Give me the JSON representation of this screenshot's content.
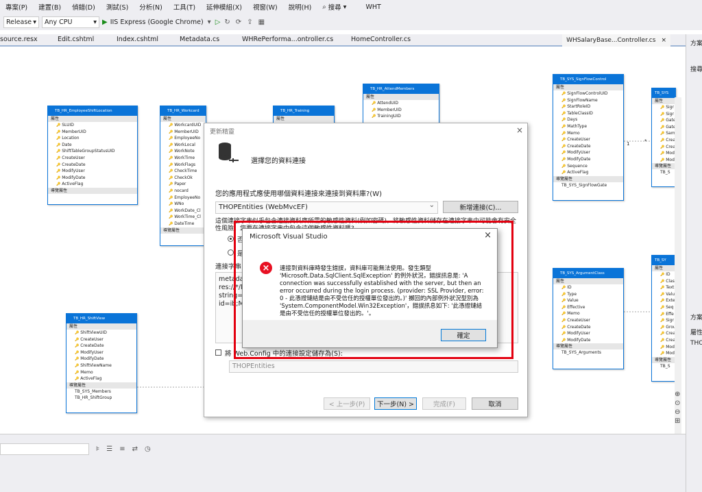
{
  "menu": {
    "items": [
      "專案(P)",
      "建置(B)",
      "偵錯(D)",
      "測試(S)",
      "分析(N)",
      "工具(T)",
      "延伸模組(X)",
      "視窗(W)",
      "說明(H)"
    ],
    "search_label": "搜尋",
    "search_icon": "search-icon",
    "solution_name": "WHT"
  },
  "toolbar": {
    "config": "Release",
    "platform": "Any CPU",
    "run_label": "IIS Express (Google Chrome)"
  },
  "tabs": [
    "source.resx",
    "Edit.cshtml",
    "Index.cshtml",
    "Metadata.cs",
    "WHRePerforma...ontroller.cs",
    "HomeController.cs"
  ],
  "tab_right": {
    "label": "WHSalaryBase...Controller.cs",
    "close": "×"
  },
  "rightpanel": {
    "text1": "方案",
    "text2": "搜尋",
    "text3": "方案",
    "text4": "屬性",
    "text5": "THO"
  },
  "entities": {
    "sec_props": "屬性",
    "sec_nav": "導覽屬性",
    "shift_location": {
      "title": "TB_HR_EmployeeShiftLocation",
      "props": [
        "SLUID",
        "MemberUID",
        "Location",
        "Date",
        "ShiftTableGroupStatusUID",
        "CreateUser",
        "CreateDate",
        "ModifyUser",
        "ModifyDate",
        "ActiveFlag"
      ]
    },
    "workcard": {
      "title": "TB_HR_Workcard",
      "props": [
        "WorkcardUID",
        "MemberUID",
        "EmployeeNo",
        "WorkLocal",
        "WorkNote",
        "WorkTime",
        "WorkFlags",
        "CheckTime",
        "CheckOk",
        "Paper",
        "nocard",
        "EmployeeNo",
        "WNo",
        "WorkDate_Cl",
        "WorkTime_Cl",
        "DateTime"
      ]
    },
    "training": {
      "title": "TB_HR_Training"
    },
    "attend": {
      "title": "TB_HR_AttendMembers",
      "props": [
        "AttendUID",
        "MemberUID",
        "TrainingUID"
      ]
    },
    "signflow": {
      "title": "TB_SYS_SignFlowControl",
      "props": [
        "SignFlowControlUID",
        "SignFlowName",
        "StartRoleID",
        "TableClassID",
        "Days",
        "MathType",
        "Memo",
        "CreateUser",
        "CreateDate",
        "ModifyUser",
        "ModifyDate",
        "Sequence",
        "ActiveFlag"
      ],
      "navs": [
        "TB_SYS_SignFlowGate"
      ]
    },
    "right_top": {
      "title": "TB_SYS",
      "props": [
        "Sigr",
        "Sigr",
        "Gate",
        "Gate",
        "Sam",
        "Crea",
        "Crea",
        "Mod",
        "Mod"
      ],
      "navs": [
        "TB_S"
      ]
    },
    "shiftview": {
      "title": "TB_HR_ShiftView",
      "props": [
        "ShiftViewUID",
        "CreateUser",
        "CreateDate",
        "ModifyUser",
        "ModifyDate",
        "ShiftViewName",
        "Memo",
        "ActiveFlag"
      ],
      "navs": [
        "TB_SYS_Members",
        "TB_HR_ShiftGroup"
      ]
    },
    "argclass": {
      "title": "TB_SYS_ArgumentClass",
      "props": [
        "ID",
        "Type",
        "Value",
        "Effective",
        "Memo",
        "CreateUser",
        "CreateDate",
        "ModifyUser",
        "ModifyDate"
      ],
      "navs": [
        "TB_SYS_Arguments"
      ]
    },
    "right_bottom": {
      "title": "TB_SY",
      "props": [
        "ID",
        "Clas",
        "Text",
        "Valu",
        "Exte",
        "Seq",
        "Effe",
        "Sigr",
        "Grou",
        "Crea",
        "Crea",
        "Mod",
        "Mod"
      ],
      "navs": [
        "TB_S"
      ]
    }
  },
  "relations": {
    "one": "1",
    "many": "*"
  },
  "wizard": {
    "title": "更新精靈",
    "heading": "選擇您的資料連接",
    "question": "您的應用程式應使用哪個資料連接來連接到資料庫?(W)",
    "connection": "THOPEntities (WebMvcEF)",
    "new_connection": "新增連接(C)...",
    "warning": "這個連接字串似乎包含連接資料庫所需的敏感性資料(例如密碼)。將敏感性資料儲存在連接字串中可能會有安全性風險。您要在連接字串中包含這個敏感性資料嗎?",
    "radio_no": "否",
    "radio_yes": "是",
    "cs_label": "連接字串:",
    "cs_lines": [
      "metadata=",
      "res://*/M",
      "string=\"d",
      "id=ib;Mo"
    ],
    "save_label": "將 Web.Config 中的連接設定儲存為(S):",
    "save_name": "THOPEntities",
    "back": "< 上一步(P)",
    "next": "下一步(N) >",
    "finish": "完成(F)",
    "cancel": "取消"
  },
  "msgbox": {
    "title": "Microsoft Visual Studio",
    "text": "連接到資料庫時發生錯誤，資料庫可能無法使用。發生類型 'Microsoft.Data.SqlClient.SqlException' 的例外狀況，錯誤訊息是: 'A connection was successfully established with the server, but then an error occurred during the login process. (provider: SSL Provider, error: 0 - 此憑證鏈結是由不受信任的授權單位發出的。)' 擲回的內部例外狀況型別為 'System.ComponentModel.Win32Exception'，錯誤訊息如下: '此憑證鏈結是由不受信任的授權單位發出的。'。",
    "ok": "確定",
    "close": "×",
    "icon": "error-icon"
  },
  "colors": {
    "accent": "#0a74d8",
    "highlight": "#e3000f",
    "error": "#e81123"
  }
}
